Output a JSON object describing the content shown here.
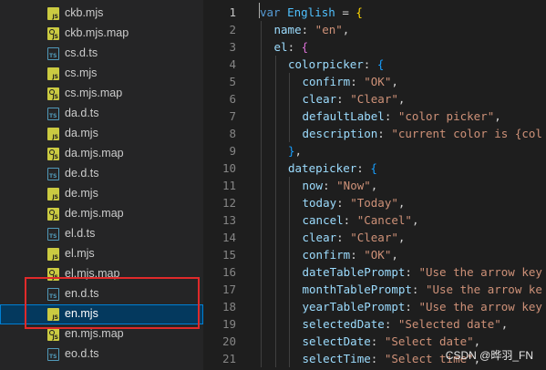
{
  "explorer": {
    "files": [
      {
        "name": "ckb.mjs",
        "icon": "js-file-icon",
        "type": "js"
      },
      {
        "name": "ckb.mjs.map",
        "icon": "js-map-file-icon",
        "type": "map"
      },
      {
        "name": "cs.d.ts",
        "icon": "ts-file-icon",
        "type": "ts"
      },
      {
        "name": "cs.mjs",
        "icon": "js-file-icon",
        "type": "js"
      },
      {
        "name": "cs.mjs.map",
        "icon": "js-map-file-icon",
        "type": "map"
      },
      {
        "name": "da.d.ts",
        "icon": "ts-file-icon",
        "type": "ts"
      },
      {
        "name": "da.mjs",
        "icon": "js-file-icon",
        "type": "js"
      },
      {
        "name": "da.mjs.map",
        "icon": "js-map-file-icon",
        "type": "map"
      },
      {
        "name": "de.d.ts",
        "icon": "ts-file-icon",
        "type": "ts"
      },
      {
        "name": "de.mjs",
        "icon": "js-file-icon",
        "type": "js"
      },
      {
        "name": "de.mjs.map",
        "icon": "js-map-file-icon",
        "type": "map"
      },
      {
        "name": "el.d.ts",
        "icon": "ts-file-icon",
        "type": "ts"
      },
      {
        "name": "el.mjs",
        "icon": "js-file-icon",
        "type": "js"
      },
      {
        "name": "el.mjs.map",
        "icon": "js-map-file-icon",
        "type": "map"
      },
      {
        "name": "en.d.ts",
        "icon": "ts-file-icon",
        "type": "ts"
      },
      {
        "name": "en.mjs",
        "icon": "js-file-icon",
        "type": "js",
        "selected": true
      },
      {
        "name": "en.mjs.map",
        "icon": "js-map-file-icon",
        "type": "map"
      },
      {
        "name": "eo.d.ts",
        "icon": "ts-file-icon",
        "type": "ts"
      }
    ],
    "icon_labels": {
      "ts": "TS",
      "js": "JS"
    },
    "highlight_color": "#e02a2a",
    "selection_color": "#04395e"
  },
  "editor": {
    "current_line": 1,
    "lines": [
      {
        "n": 1,
        "indent": 0,
        "tokens": [
          [
            "kw",
            "var"
          ],
          [
            "punc",
            " "
          ],
          [
            "var",
            "English"
          ],
          [
            "punc",
            " = "
          ],
          [
            "b1",
            "{"
          ]
        ]
      },
      {
        "n": 2,
        "indent": 1,
        "tokens": [
          [
            "prop",
            "name"
          ],
          [
            "punc",
            ": "
          ],
          [
            "str",
            "\"en\""
          ],
          [
            "punc",
            ","
          ]
        ]
      },
      {
        "n": 3,
        "indent": 1,
        "tokens": [
          [
            "prop",
            "el"
          ],
          [
            "punc",
            ": "
          ],
          [
            "b2",
            "{"
          ]
        ]
      },
      {
        "n": 4,
        "indent": 2,
        "tokens": [
          [
            "prop",
            "colorpicker"
          ],
          [
            "punc",
            ": "
          ],
          [
            "b3",
            "{"
          ]
        ]
      },
      {
        "n": 5,
        "indent": 3,
        "tokens": [
          [
            "prop",
            "confirm"
          ],
          [
            "punc",
            ": "
          ],
          [
            "str",
            "\"OK\""
          ],
          [
            "punc",
            ","
          ]
        ]
      },
      {
        "n": 6,
        "indent": 3,
        "tokens": [
          [
            "prop",
            "clear"
          ],
          [
            "punc",
            ": "
          ],
          [
            "str",
            "\"Clear\""
          ],
          [
            "punc",
            ","
          ]
        ]
      },
      {
        "n": 7,
        "indent": 3,
        "tokens": [
          [
            "prop",
            "defaultLabel"
          ],
          [
            "punc",
            ": "
          ],
          [
            "str",
            "\"color picker\""
          ],
          [
            "punc",
            ","
          ]
        ]
      },
      {
        "n": 8,
        "indent": 3,
        "tokens": [
          [
            "prop",
            "description"
          ],
          [
            "punc",
            ": "
          ],
          [
            "str",
            "\"current color is {col"
          ]
        ]
      },
      {
        "n": 9,
        "indent": 2,
        "tokens": [
          [
            "b3",
            "}"
          ],
          [
            "punc",
            ","
          ]
        ]
      },
      {
        "n": 10,
        "indent": 2,
        "tokens": [
          [
            "prop",
            "datepicker"
          ],
          [
            "punc",
            ": "
          ],
          [
            "b3",
            "{"
          ]
        ]
      },
      {
        "n": 11,
        "indent": 3,
        "tokens": [
          [
            "prop",
            "now"
          ],
          [
            "punc",
            ": "
          ],
          [
            "str",
            "\"Now\""
          ],
          [
            "punc",
            ","
          ]
        ]
      },
      {
        "n": 12,
        "indent": 3,
        "tokens": [
          [
            "prop",
            "today"
          ],
          [
            "punc",
            ": "
          ],
          [
            "str",
            "\"Today\""
          ],
          [
            "punc",
            ","
          ]
        ]
      },
      {
        "n": 13,
        "indent": 3,
        "tokens": [
          [
            "prop",
            "cancel"
          ],
          [
            "punc",
            ": "
          ],
          [
            "str",
            "\"Cancel\""
          ],
          [
            "punc",
            ","
          ]
        ]
      },
      {
        "n": 14,
        "indent": 3,
        "tokens": [
          [
            "prop",
            "clear"
          ],
          [
            "punc",
            ": "
          ],
          [
            "str",
            "\"Clear\""
          ],
          [
            "punc",
            ","
          ]
        ]
      },
      {
        "n": 15,
        "indent": 3,
        "tokens": [
          [
            "prop",
            "confirm"
          ],
          [
            "punc",
            ": "
          ],
          [
            "str",
            "\"OK\""
          ],
          [
            "punc",
            ","
          ]
        ]
      },
      {
        "n": 16,
        "indent": 3,
        "tokens": [
          [
            "prop",
            "dateTablePrompt"
          ],
          [
            "punc",
            ": "
          ],
          [
            "str",
            "\"Use the arrow key"
          ]
        ]
      },
      {
        "n": 17,
        "indent": 3,
        "tokens": [
          [
            "prop",
            "monthTablePrompt"
          ],
          [
            "punc",
            ": "
          ],
          [
            "str",
            "\"Use the arrow ke"
          ]
        ]
      },
      {
        "n": 18,
        "indent": 3,
        "tokens": [
          [
            "prop",
            "yearTablePrompt"
          ],
          [
            "punc",
            ": "
          ],
          [
            "str",
            "\"Use the arrow key"
          ]
        ]
      },
      {
        "n": 19,
        "indent": 3,
        "tokens": [
          [
            "prop",
            "selectedDate"
          ],
          [
            "punc",
            ": "
          ],
          [
            "str",
            "\"Selected date\""
          ],
          [
            "punc",
            ","
          ]
        ]
      },
      {
        "n": 20,
        "indent": 3,
        "tokens": [
          [
            "prop",
            "selectDate"
          ],
          [
            "punc",
            ": "
          ],
          [
            "str",
            "\"Select date\""
          ],
          [
            "punc",
            ","
          ]
        ]
      },
      {
        "n": 21,
        "indent": 3,
        "tokens": [
          [
            "prop",
            "selectTime"
          ],
          [
            "punc",
            ": "
          ],
          [
            "str",
            "\"Select time\""
          ],
          [
            "punc",
            ","
          ]
        ]
      }
    ]
  },
  "watermark": "CSDN @晔羽_FN"
}
